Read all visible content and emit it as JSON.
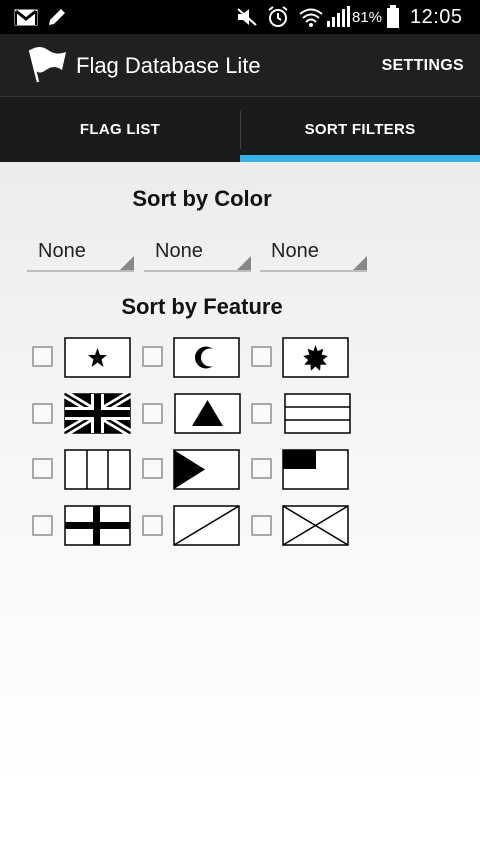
{
  "status_bar": {
    "icons_left": [
      "gmail-icon",
      "pencil-icon"
    ],
    "icons_right": [
      "mute-icon",
      "alarm-icon",
      "wifi-icon",
      "signal-icon"
    ],
    "battery_percent": "81%",
    "time": "12:05"
  },
  "action_bar": {
    "title": "Flag Database Lite",
    "settings_label": "SETTINGS",
    "icon": "white-flag-icon"
  },
  "tabs": [
    {
      "label": "FLAG LIST",
      "selected": false
    },
    {
      "label": "SORT FILTERS",
      "selected": true
    }
  ],
  "colors": {
    "accent": "#33b5e5",
    "action_bar": "#202020",
    "tab_bar": "#1b1b1b"
  },
  "sort_by_color": {
    "title": "Sort by Color",
    "spinners": [
      "None",
      "None",
      "None"
    ]
  },
  "sort_by_feature": {
    "title": "Sort by Feature",
    "features": [
      {
        "icon": "star-flag-icon",
        "checked": false
      },
      {
        "icon": "crescent-flag-icon",
        "checked": false
      },
      {
        "icon": "sun-flag-icon",
        "checked": false
      },
      {
        "icon": "union-jack-flag-icon",
        "checked": false
      },
      {
        "icon": "triangle-flag-icon",
        "checked": false
      },
      {
        "icon": "horizontal-stripes-flag-icon",
        "checked": false
      },
      {
        "icon": "vertical-stripes-flag-icon",
        "checked": false
      },
      {
        "icon": "hoist-triangle-flag-icon",
        "checked": false
      },
      {
        "icon": "canton-flag-icon",
        "checked": false
      },
      {
        "icon": "nordic-cross-flag-icon",
        "checked": false
      },
      {
        "icon": "diagonal-flag-icon",
        "checked": false
      },
      {
        "icon": "saltire-flag-icon",
        "checked": false
      }
    ]
  }
}
